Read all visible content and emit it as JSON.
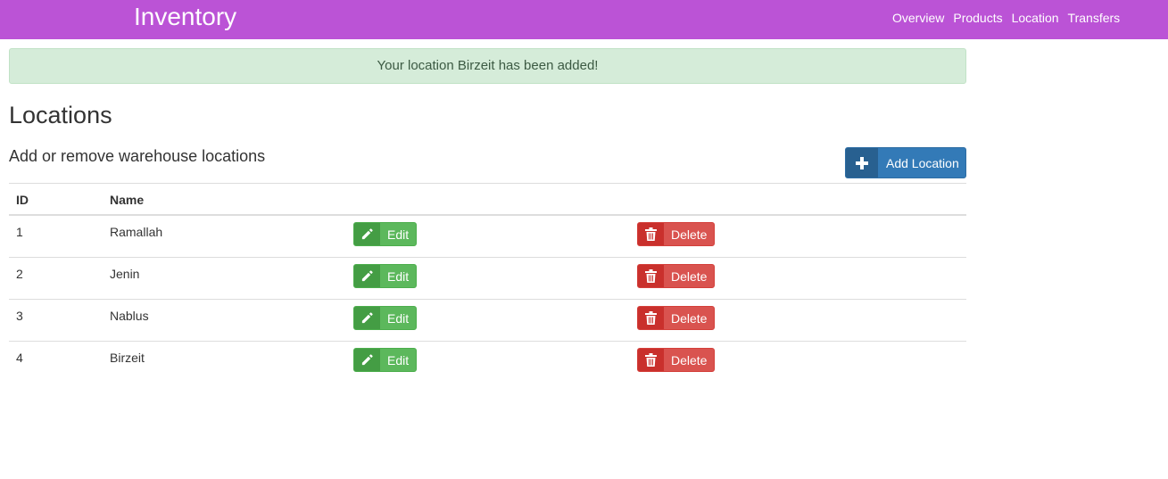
{
  "navbar": {
    "brand": "Inventory",
    "links": [
      "Overview",
      "Products",
      "Location",
      "Transfers"
    ],
    "color": "#bb53d6"
  },
  "alert": {
    "message": "Your location Birzeit has been added!",
    "type": "success"
  },
  "page": {
    "title": "Locations",
    "subtitle": "Add or remove warehouse locations",
    "add_button_label": "Add Location",
    "add_button_icon": "plus-icon"
  },
  "table": {
    "headers": [
      "ID",
      "Name",
      "",
      ""
    ],
    "rows": [
      {
        "id": "1",
        "name": "Ramallah"
      },
      {
        "id": "2",
        "name": "Jenin"
      },
      {
        "id": "3",
        "name": "Nablus"
      },
      {
        "id": "4",
        "name": "Birzeit"
      }
    ],
    "edit_label": "Edit",
    "edit_icon": "pencil-icon",
    "delete_label": "Delete",
    "delete_icon": "trash-icon"
  },
  "colors": {
    "primary": "#337ab7",
    "success": "#5cb85c",
    "danger": "#d9534f",
    "alert_bg": "#d5ecd9"
  }
}
